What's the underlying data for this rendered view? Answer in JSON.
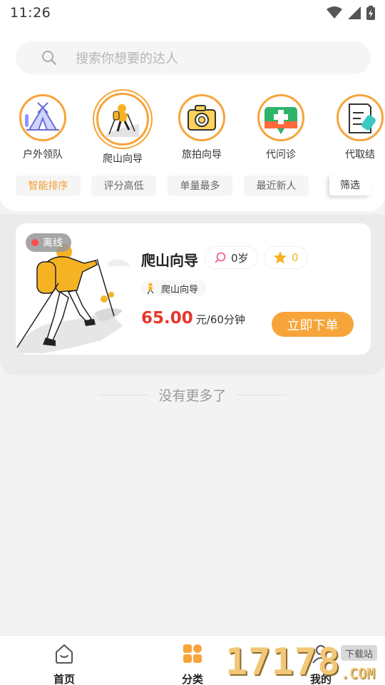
{
  "status_bar": {
    "time": "11:26"
  },
  "search": {
    "placeholder": "搜索你想要的达人",
    "icon": "search-icon"
  },
  "categories": [
    {
      "label": "户外领队",
      "icon": "tent-icon",
      "selected": false
    },
    {
      "label": "爬山向导",
      "icon": "hiker-icon",
      "selected": true
    },
    {
      "label": "旅拍向导",
      "icon": "camera-icon",
      "selected": false
    },
    {
      "label": "代问诊",
      "icon": "medical-icon",
      "selected": false
    },
    {
      "label": "代取结",
      "icon": "report-icon",
      "selected": false
    }
  ],
  "sort_options": [
    {
      "label": "智能排序",
      "active": true
    },
    {
      "label": "评分高低",
      "active": false
    },
    {
      "label": "单量最多",
      "active": false
    },
    {
      "label": "最近新人",
      "active": false
    }
  ],
  "filter_label": "筛选",
  "listing": {
    "status": "离线",
    "title": "爬山向导",
    "age": "0岁",
    "rating": "0",
    "tag": "爬山向导",
    "price": "65.00",
    "price_unit": "元/60分钟",
    "order_button": "立即下单"
  },
  "no_more_text": "没有更多了",
  "tabs": [
    {
      "label": "首页",
      "icon": "home-icon"
    },
    {
      "label": "分类",
      "icon": "grid-icon"
    },
    {
      "label": "我的",
      "icon": "profile-icon"
    }
  ],
  "watermark": {
    "number": "17178",
    "tag": "下载站",
    "domain": ".COM"
  },
  "colors": {
    "accent": "#f7a43a",
    "price": "#e5362b",
    "offline_dot": "#ff4b4b"
  }
}
